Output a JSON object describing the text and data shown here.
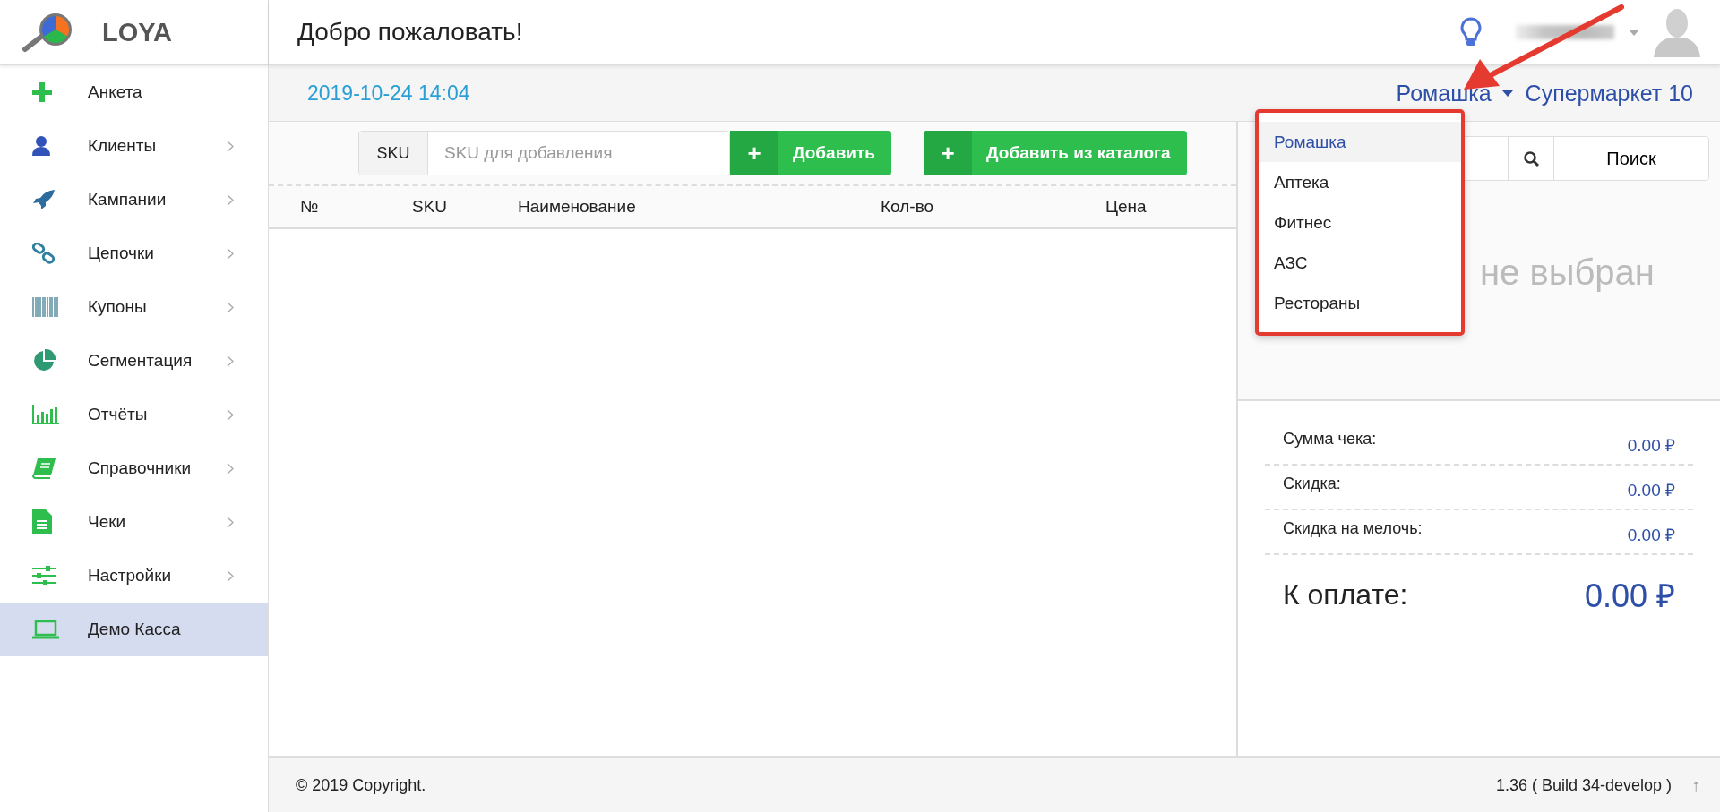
{
  "logo": {
    "text": "LOYA"
  },
  "sidebar": {
    "items": [
      {
        "label": "Анкета",
        "expandable": false,
        "selected": false
      },
      {
        "label": "Клиенты",
        "expandable": true,
        "selected": false
      },
      {
        "label": "Кампании",
        "expandable": true,
        "selected": false
      },
      {
        "label": "Цепочки",
        "expandable": true,
        "selected": false
      },
      {
        "label": "Купоны",
        "expandable": true,
        "selected": false
      },
      {
        "label": "Сегментация",
        "expandable": true,
        "selected": false
      },
      {
        "label": "Отчёты",
        "expandable": true,
        "selected": false
      },
      {
        "label": "Справочники",
        "expandable": true,
        "selected": false
      },
      {
        "label": "Чеки",
        "expandable": true,
        "selected": false
      },
      {
        "label": "Настройки",
        "expandable": true,
        "selected": false
      },
      {
        "label": "Демо Касса",
        "expandable": false,
        "selected": true
      }
    ]
  },
  "header": {
    "title": "Добро пожаловать!"
  },
  "subbar": {
    "datetime": "2019-10-24 14:04",
    "brand": "Ромашка",
    "store": "Супермаркет 10"
  },
  "brand_menu": {
    "items": [
      {
        "label": "Ромашка",
        "selected": true
      },
      {
        "label": "Аптека",
        "selected": false
      },
      {
        "label": "Фитнес",
        "selected": false
      },
      {
        "label": "АЗС",
        "selected": false
      },
      {
        "label": "Рестораны",
        "selected": false
      }
    ]
  },
  "sku_input": {
    "addon": "SKU",
    "placeholder": "SKU для добавления"
  },
  "buttons": [
    {
      "icon": "+",
      "label": "Добавить"
    },
    {
      "icon": "+",
      "label": "Добавить из каталога"
    }
  ],
  "table": {
    "columns": [
      "№",
      "SKU",
      "Наименование",
      "Кол-во",
      "Цена"
    ]
  },
  "client_panel": {
    "search_button": "Поиск",
    "status": "не выбран"
  },
  "totals": [
    {
      "label": "Сумма чека:",
      "value": "0.00 ₽"
    },
    {
      "label": "Скидка:",
      "value": "0.00 ₽"
    },
    {
      "label": "Скидка на мелочь:",
      "value": "0.00 ₽"
    }
  ],
  "to_pay": {
    "label": "К оплате:",
    "value": "0.00 ₽"
  },
  "footer": {
    "copyright": "© 2019 Copyright.",
    "version": "1.36 ( Build 34-develop )",
    "up": "↑"
  }
}
